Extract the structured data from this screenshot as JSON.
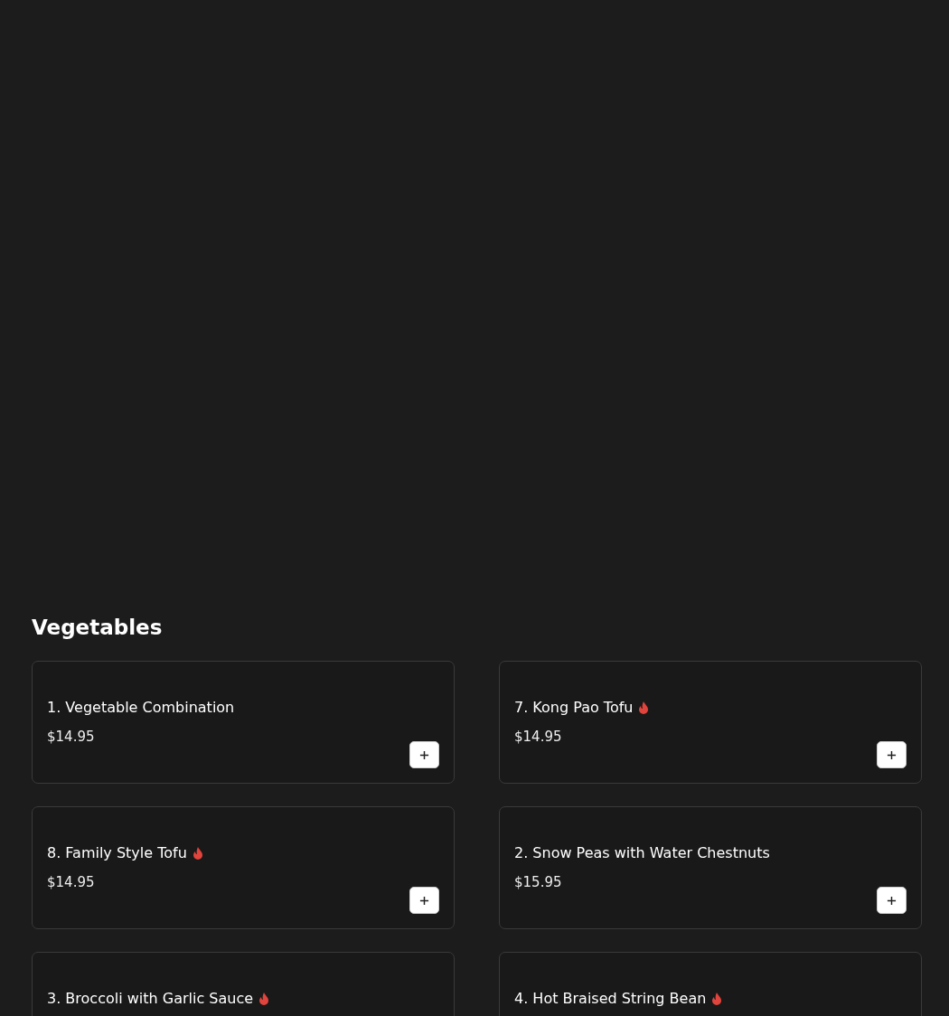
{
  "section": {
    "title": "Vegetables"
  },
  "items": [
    {
      "name": "1. Vegetable Combination",
      "spicy": false,
      "price": "$14.95"
    },
    {
      "name": "7. Kong Pao Tofu",
      "spicy": true,
      "price": "$14.95"
    },
    {
      "name": "8. Family Style Tofu",
      "spicy": true,
      "price": "$14.95"
    },
    {
      "name": "2. Snow Peas with Water Chestnuts",
      "spicy": false,
      "price": "$15.95"
    },
    {
      "name": "3. Broccoli with Garlic Sauce",
      "spicy": true
    },
    {
      "name": "4. Hot Braised String Bean",
      "spicy": true
    }
  ]
}
